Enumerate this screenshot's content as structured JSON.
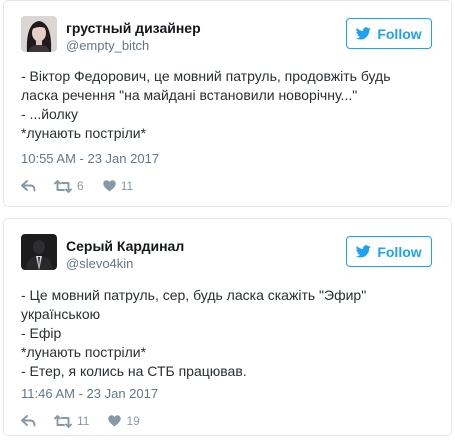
{
  "follow_label": "Follow",
  "colors": {
    "accent": "#1da1f2",
    "text": "#292f33",
    "muted": "#657786",
    "border": "#e1e8ed"
  },
  "tweets": [
    {
      "author_name": "грустный дизайнер",
      "author_handle": "@empty_bitch",
      "lines": [
        "- Віктор Федорович, це мовний патруль, продовжіть будь",
        "ласка речення \"на майдані встановили новорічну...\"",
        "- ...йолку",
        "*лунають постріли*"
      ],
      "timestamp": "10:55 AM - 23 Jan 2017",
      "retweets": "6",
      "likes": "11",
      "icons": [
        "reply-icon",
        "retweet-icon",
        "heart-icon"
      ]
    },
    {
      "author_name": "Серый Кардинал",
      "author_handle": "@slevo4kin",
      "lines": [
        "- Це мовний патруль, сер, будь ласка скажіть \"Эфир\" українською",
        "- Ефір",
        "*лунають постріли*",
        "- Етер, я колись на СТБ працював."
      ],
      "timestamp": "11:46 AM - 23 Jan 2017",
      "retweets": "11",
      "likes": "19",
      "icons": [
        "reply-icon",
        "retweet-icon",
        "heart-icon"
      ]
    }
  ]
}
